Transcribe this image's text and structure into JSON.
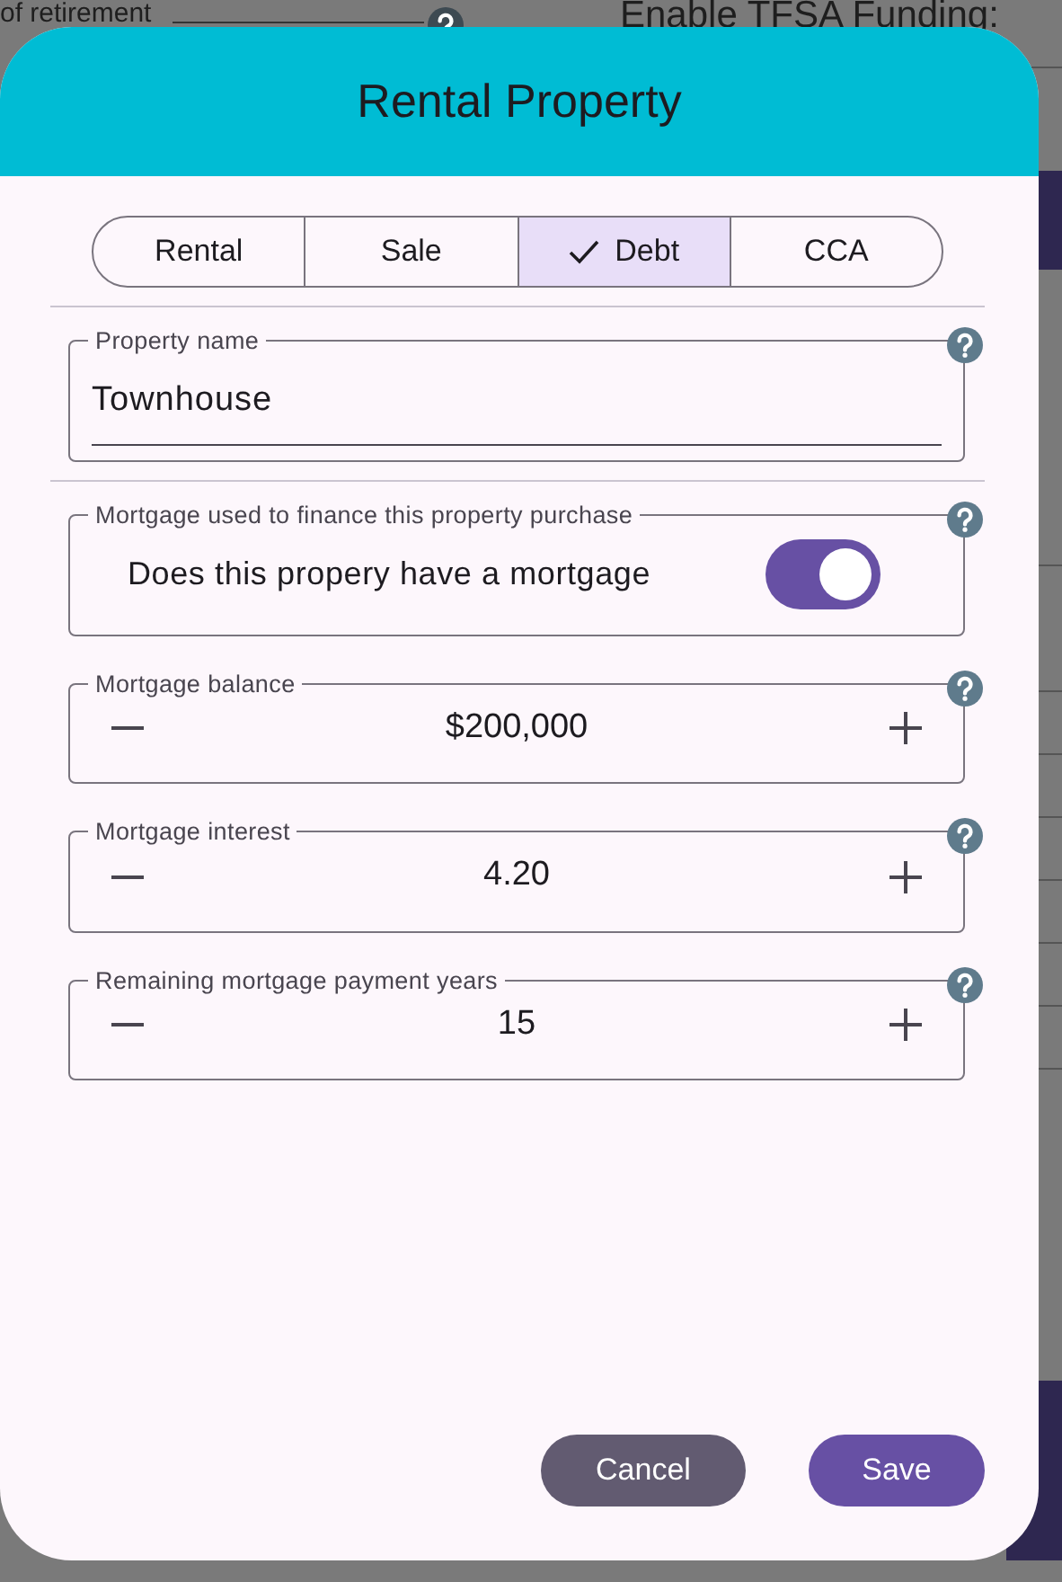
{
  "backdrop": {
    "top_left_label": "of retirement",
    "top_right_label": "Enable TFSA Funding:"
  },
  "dialog": {
    "title": "Rental Property",
    "tabs": [
      {
        "label": "Rental",
        "selected": false
      },
      {
        "label": "Sale",
        "selected": false
      },
      {
        "label": "Debt",
        "selected": true
      },
      {
        "label": "CCA",
        "selected": false
      }
    ],
    "groups": [
      [
        {
          "kind": "text",
          "label": "Property name",
          "value": "Townhouse"
        }
      ],
      [
        {
          "kind": "toggle",
          "label": "Mortgage used to finance this property purchase",
          "text": "Does this propery have a mortgage",
          "on": true
        },
        {
          "kind": "stepper",
          "label": "Mortgage balance",
          "value": "$200,000"
        },
        {
          "kind": "stepper",
          "label": "Mortgage interest",
          "value": "4.20"
        },
        {
          "kind": "stepper",
          "label": "Remaining mortgage payment years",
          "value": "15"
        }
      ]
    ],
    "buttons": [
      {
        "label": "Cancel",
        "kind": "secondary"
      },
      {
        "label": "Save",
        "kind": "primary"
      }
    ]
  }
}
